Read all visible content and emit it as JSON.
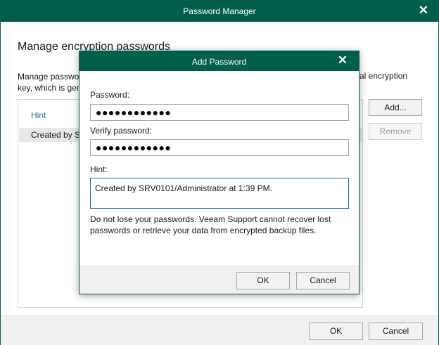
{
  "main": {
    "title": "Password Manager",
    "heading": "Manage encryption passwords",
    "description_left": "Manage passwor",
    "description_line2": "key, which is gen",
    "description_right": "al encryption",
    "list": {
      "header": "Hint",
      "rows": [
        "Created by SR"
      ]
    },
    "add_label": "Add...",
    "remove_label": "Remove",
    "ok_label": "OK",
    "cancel_label": "Cancel"
  },
  "dialog": {
    "title": "Add Password",
    "password_label": "Password:",
    "password_value": "●●●●●●●●●●●●",
    "verify_label": "Verify password:",
    "verify_value": "●●●●●●●●●●●●",
    "hint_label": "Hint:",
    "hint_value": "Created by SRV0101/Administrator at 1:39 PM.",
    "warning": "Do not lose your passwords. Veeam Support cannot recover lost passwords or retrieve your data from encrypted backup files.",
    "ok_label": "OK",
    "cancel_label": "Cancel"
  },
  "icons": {
    "close": "close-icon"
  },
  "colors": {
    "titlebar": "#005f4b",
    "link": "#1a6ca8",
    "selected_row": "#e8e8e8"
  }
}
